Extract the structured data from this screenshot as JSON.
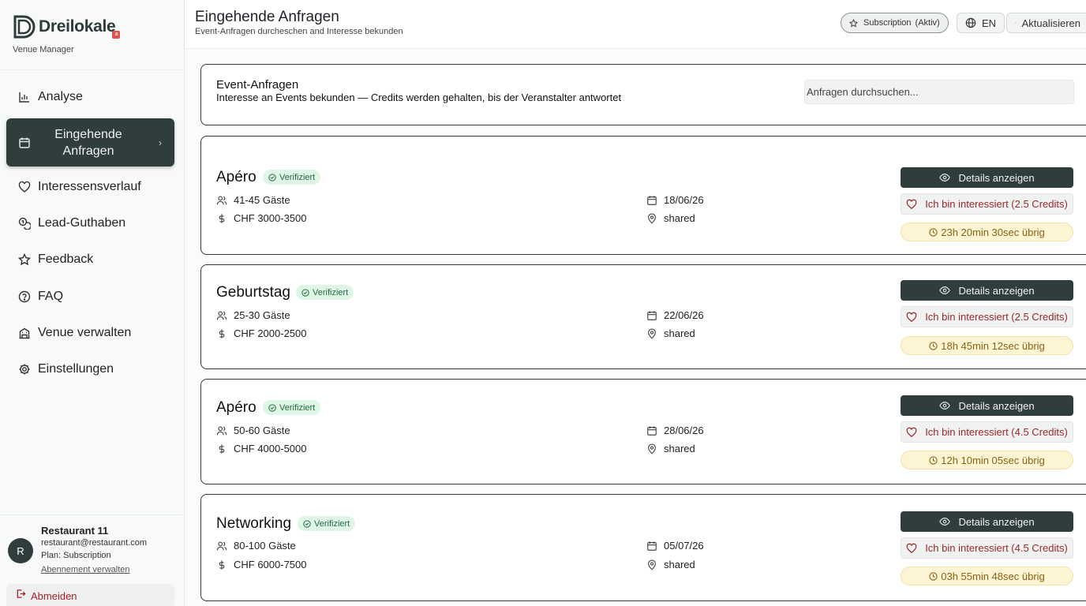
{
  "brand": {
    "name": "Dreilokale",
    "subtitle": "Venue Manager",
    "badge": "a"
  },
  "sidebar": {
    "items": [
      {
        "label": "Analyse",
        "icon": "bar-chart-icon"
      },
      {
        "label": "Eingehende Anfragen",
        "icon": "calendar-icon",
        "active": true
      },
      {
        "label": "Interessensverlauf",
        "icon": "heart-icon"
      },
      {
        "label": "Lead-Guthaben",
        "icon": "coins-icon"
      },
      {
        "label": "Feedback",
        "icon": "star-icon"
      },
      {
        "label": "FAQ",
        "icon": "help-circle-icon"
      },
      {
        "label": "Venue verwalten",
        "icon": "building-icon"
      },
      {
        "label": "Einstellungen",
        "icon": "gear-icon"
      }
    ],
    "chevron": "›"
  },
  "user": {
    "initial": "R",
    "name": "Restaurant 11",
    "email": "restaurant@restaurant.com",
    "plan": "Plan: Subscription",
    "manage": "Abennement verwalten",
    "logout": "Abmeiden"
  },
  "header": {
    "title": "Eingehende Anfragen",
    "subtitle": "Event-Anfragen durcheschen and Interesse bekunden",
    "subscription": "Subscription",
    "subscription_status": "(Aktiv)",
    "lang": "EN",
    "refresh": "Aktualisieren"
  },
  "filter": {
    "title": "Event-Anfragen",
    "description": "Interesse an Events bekunden — Credits werden gehalten, bis der Veranstalter antwortet",
    "search_placeholder": "Anfragen durchsuchen..."
  },
  "requests": [
    {
      "title": "Apéro",
      "badge": "Verifiziert",
      "guests": "41-45 Gäste",
      "budget": "CHF 3000-3500",
      "date": "18/06/26",
      "location": "shared",
      "details": "Details anzeigen",
      "interest": "Ich bin interessiert (2.5 Credits)",
      "timer": "23h 20min 30sec übrig"
    },
    {
      "title": "Geburtstag",
      "badge": "Verifiziert",
      "guests": "25-30 Gäste",
      "budget": "CHF 2000-2500",
      "date": "22/06/26",
      "location": "shared",
      "details": "Details anzeigen",
      "interest": "Ich bin interessiert (2.5 Credits)",
      "timer": "18h 45min 12sec übrig"
    },
    {
      "title": "Apéro",
      "badge": "Verifiziert",
      "guests": "50-60 Gäste",
      "budget": "CHF 4000-5000",
      "date": "28/06/26",
      "location": "shared",
      "details": "Details anzeigen",
      "interest": "Ich bin interessiert (4.5 Credits)",
      "timer": "12h 10min 05sec übrig"
    },
    {
      "title": "Networking",
      "badge": "Verifiziert",
      "guests": "80-100 Gäste",
      "budget": "CHF 6000-7500",
      "date": "05/07/26",
      "location": "shared",
      "details": "Details anzeigen",
      "interest": "Ich bin interessiert (4.5 Credits)",
      "timer": "03h 55min 48sec übrig"
    }
  ],
  "colors": {
    "accent": "#2f3d3d",
    "danger": "#a3202a",
    "verified_bg": "#dff5e6",
    "timer_bg": "#fdf4d4"
  }
}
